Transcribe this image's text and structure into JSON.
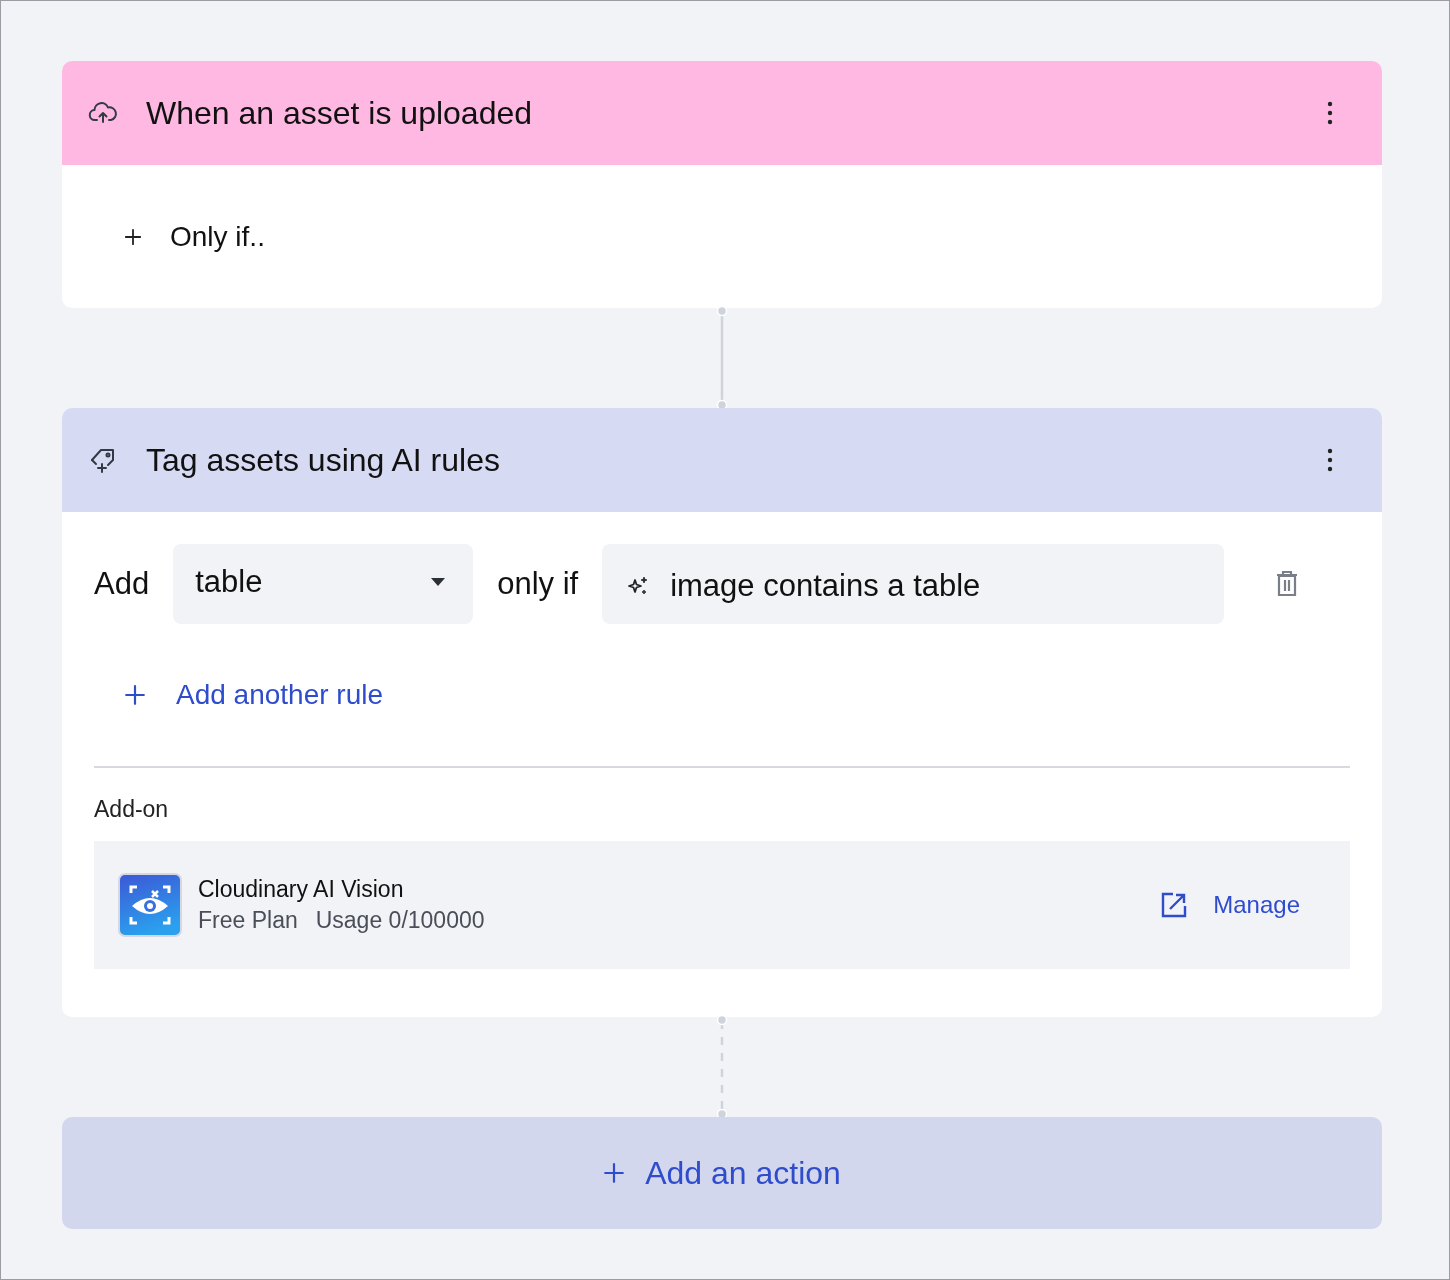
{
  "trigger": {
    "title": "When an asset is uploaded",
    "condition_label": "Only if.."
  },
  "connectors": [
    {
      "kind": "solid"
    },
    {
      "kind": "dashed"
    }
  ],
  "action": {
    "title": "Tag assets using AI rules",
    "rules": [
      {
        "prefix": "Add",
        "tag_value": "table",
        "joiner": "only if",
        "condition": "image contains a table"
      }
    ],
    "add_rule_label": "Add another rule",
    "addon": {
      "heading": "Add-on",
      "name": "Cloudinary AI Vision",
      "plan": "Free Plan",
      "usage": "Usage 0/100000",
      "manage_label": "Manage"
    }
  },
  "add_action_label": "Add an action"
}
